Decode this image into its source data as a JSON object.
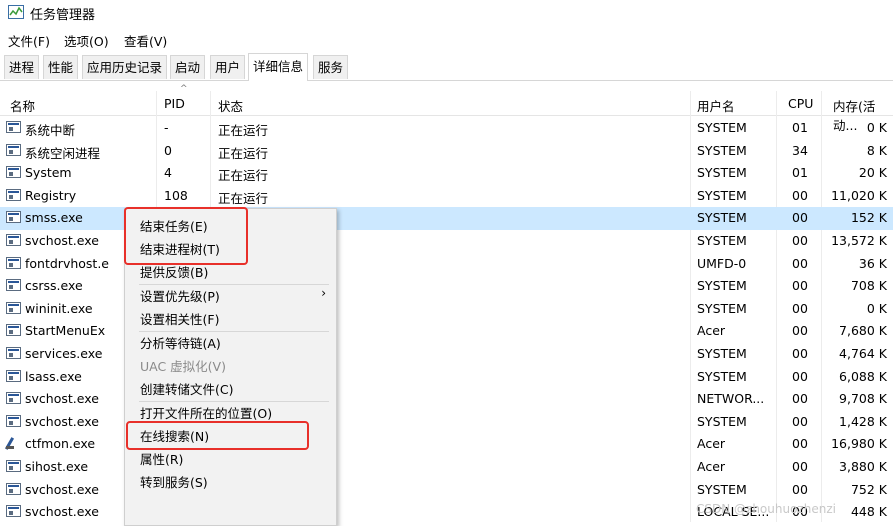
{
  "window": {
    "title": "任务管理器"
  },
  "menubar": [
    "文件(F)",
    "选项(O)",
    "查看(V)"
  ],
  "tabs": [
    "进程",
    "性能",
    "应用历史记录",
    "启动",
    "用户",
    "详细信息",
    "服务"
  ],
  "active_tab": "详细信息",
  "columns": {
    "name": "名称",
    "pid": "PID",
    "status": "状态",
    "user": "用户名",
    "cpu": "CPU",
    "mem": "内存(活动..."
  },
  "rows": [
    {
      "name": "系统中断",
      "pid": "-",
      "status": "正在运行",
      "user": "SYSTEM",
      "cpu": "01",
      "mem": "0 K"
    },
    {
      "name": "系统空闲进程",
      "pid": "0",
      "status": "正在运行",
      "user": "SYSTEM",
      "cpu": "34",
      "mem": "8 K"
    },
    {
      "name": "System",
      "pid": "4",
      "status": "正在运行",
      "user": "SYSTEM",
      "cpu": "01",
      "mem": "20 K"
    },
    {
      "name": "Registry",
      "pid": "108",
      "status": "正在运行",
      "user": "SYSTEM",
      "cpu": "00",
      "mem": "11,020 K"
    },
    {
      "name": "smss.exe",
      "pid": "",
      "status": "",
      "user": "SYSTEM",
      "cpu": "00",
      "mem": "152 K",
      "selected": true
    },
    {
      "name": "svchost.exe",
      "pid": "",
      "status": "",
      "user": "SYSTEM",
      "cpu": "00",
      "mem": "13,572 K"
    },
    {
      "name": "fontdrvhost.e",
      "pid": "",
      "status": "",
      "user": "UMFD-0",
      "cpu": "00",
      "mem": "36 K"
    },
    {
      "name": "csrss.exe",
      "pid": "",
      "status": "",
      "user": "SYSTEM",
      "cpu": "00",
      "mem": "708 K"
    },
    {
      "name": "wininit.exe",
      "pid": "",
      "status": "",
      "user": "SYSTEM",
      "cpu": "00",
      "mem": "0 K"
    },
    {
      "name": "StartMenuEx",
      "pid": "",
      "status": "",
      "user": "Acer",
      "cpu": "00",
      "mem": "7,680 K"
    },
    {
      "name": "services.exe",
      "pid": "",
      "status": "",
      "user": "SYSTEM",
      "cpu": "00",
      "mem": "4,764 K"
    },
    {
      "name": "lsass.exe",
      "pid": "",
      "status": "",
      "user": "SYSTEM",
      "cpu": "00",
      "mem": "6,088 K"
    },
    {
      "name": "svchost.exe",
      "pid": "",
      "status": "",
      "user": "NETWOR...",
      "cpu": "00",
      "mem": "9,708 K"
    },
    {
      "name": "svchost.exe",
      "pid": "",
      "status": "",
      "user": "SYSTEM",
      "cpu": "00",
      "mem": "1,428 K"
    },
    {
      "name": "ctfmon.exe",
      "pid": "",
      "status": "",
      "user": "Acer",
      "cpu": "00",
      "mem": "16,980 K",
      "icon": "ctfmon"
    },
    {
      "name": "sihost.exe",
      "pid": "",
      "status": "",
      "user": "Acer",
      "cpu": "00",
      "mem": "3,880 K"
    },
    {
      "name": "svchost.exe",
      "pid": "",
      "status": "",
      "user": "SYSTEM",
      "cpu": "00",
      "mem": "752 K"
    },
    {
      "name": "svchost.exe",
      "pid": "",
      "status": "",
      "user": "LOCAL SE...",
      "cpu": "00",
      "mem": "448 K"
    }
  ],
  "context_menu": [
    {
      "label": "结束任务(E)"
    },
    {
      "label": "结束进程树(T)"
    },
    {
      "label": "提供反馈(B)"
    },
    {
      "separator": true
    },
    {
      "label": "设置优先级(P)",
      "submenu": true
    },
    {
      "label": "设置相关性(F)"
    },
    {
      "separator": true
    },
    {
      "label": "分析等待链(A)"
    },
    {
      "label": "UAC 虚拟化(V)",
      "disabled": true
    },
    {
      "label": "创建转储文件(C)"
    },
    {
      "separator": true
    },
    {
      "label": "打开文件所在的位置(O)"
    },
    {
      "label": "在线搜索(N)"
    },
    {
      "label": "属性(R)"
    },
    {
      "label": "转到服务(S)"
    }
  ],
  "watermark": "CSDN @zhouhuozhenzi",
  "colors": {
    "selected_row": "#cce8ff",
    "highlight_box": "#e8302a"
  }
}
